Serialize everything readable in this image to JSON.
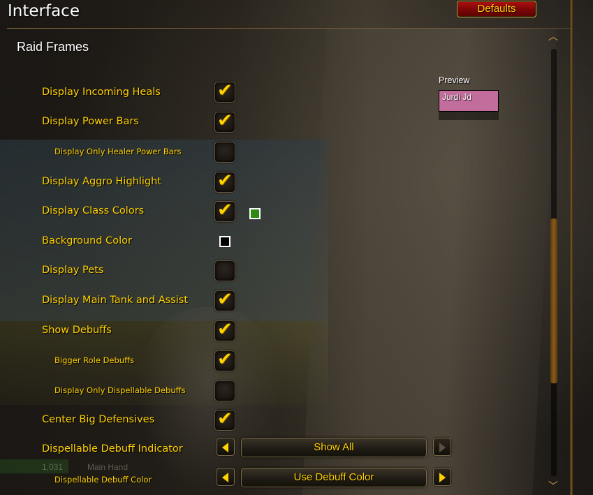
{
  "window": {
    "title": "Interface"
  },
  "header": {
    "defaults_label": "Defaults"
  },
  "section": {
    "title": "Raid Frames"
  },
  "options": [
    {
      "label": "Display Incoming Heals",
      "checked": true
    },
    {
      "label": "Display Power Bars",
      "checked": true
    },
    {
      "label": "Display Only Healer Power Bars",
      "checked": false
    },
    {
      "label": "Display Aggro Highlight",
      "checked": true
    },
    {
      "label": "Display Class Colors",
      "checked": true
    },
    {
      "label": "Background Color"
    },
    {
      "label": "Display Pets",
      "checked": false
    },
    {
      "label": "Display Main Tank and Assist",
      "checked": true
    },
    {
      "label": "Show Debuffs",
      "checked": true
    },
    {
      "label": "Bigger Role Debuffs",
      "checked": true
    },
    {
      "label": "Display Only Dispellable Debuffs",
      "checked": false
    },
    {
      "label": "Center Big Defensives",
      "checked": true
    },
    {
      "label": "Dispellable Debuff Indicator"
    },
    {
      "label": "Dispellable Debuff Color"
    }
  ],
  "check_glyph": "✔",
  "class_color_swatch": "#2e8b12",
  "background_color_swatch": "#000000",
  "preview": {
    "label": "Preview",
    "frame_name": "Jurdi Jd",
    "frame_color": "#c36d9c"
  },
  "dropdowns": {
    "dispel_indicator": {
      "selected": "Show All"
    },
    "dispel_color": {
      "selected": "Use Debuff Color"
    }
  },
  "background_ghost": {
    "value": "1,031",
    "main_hand": "Main Hand"
  }
}
